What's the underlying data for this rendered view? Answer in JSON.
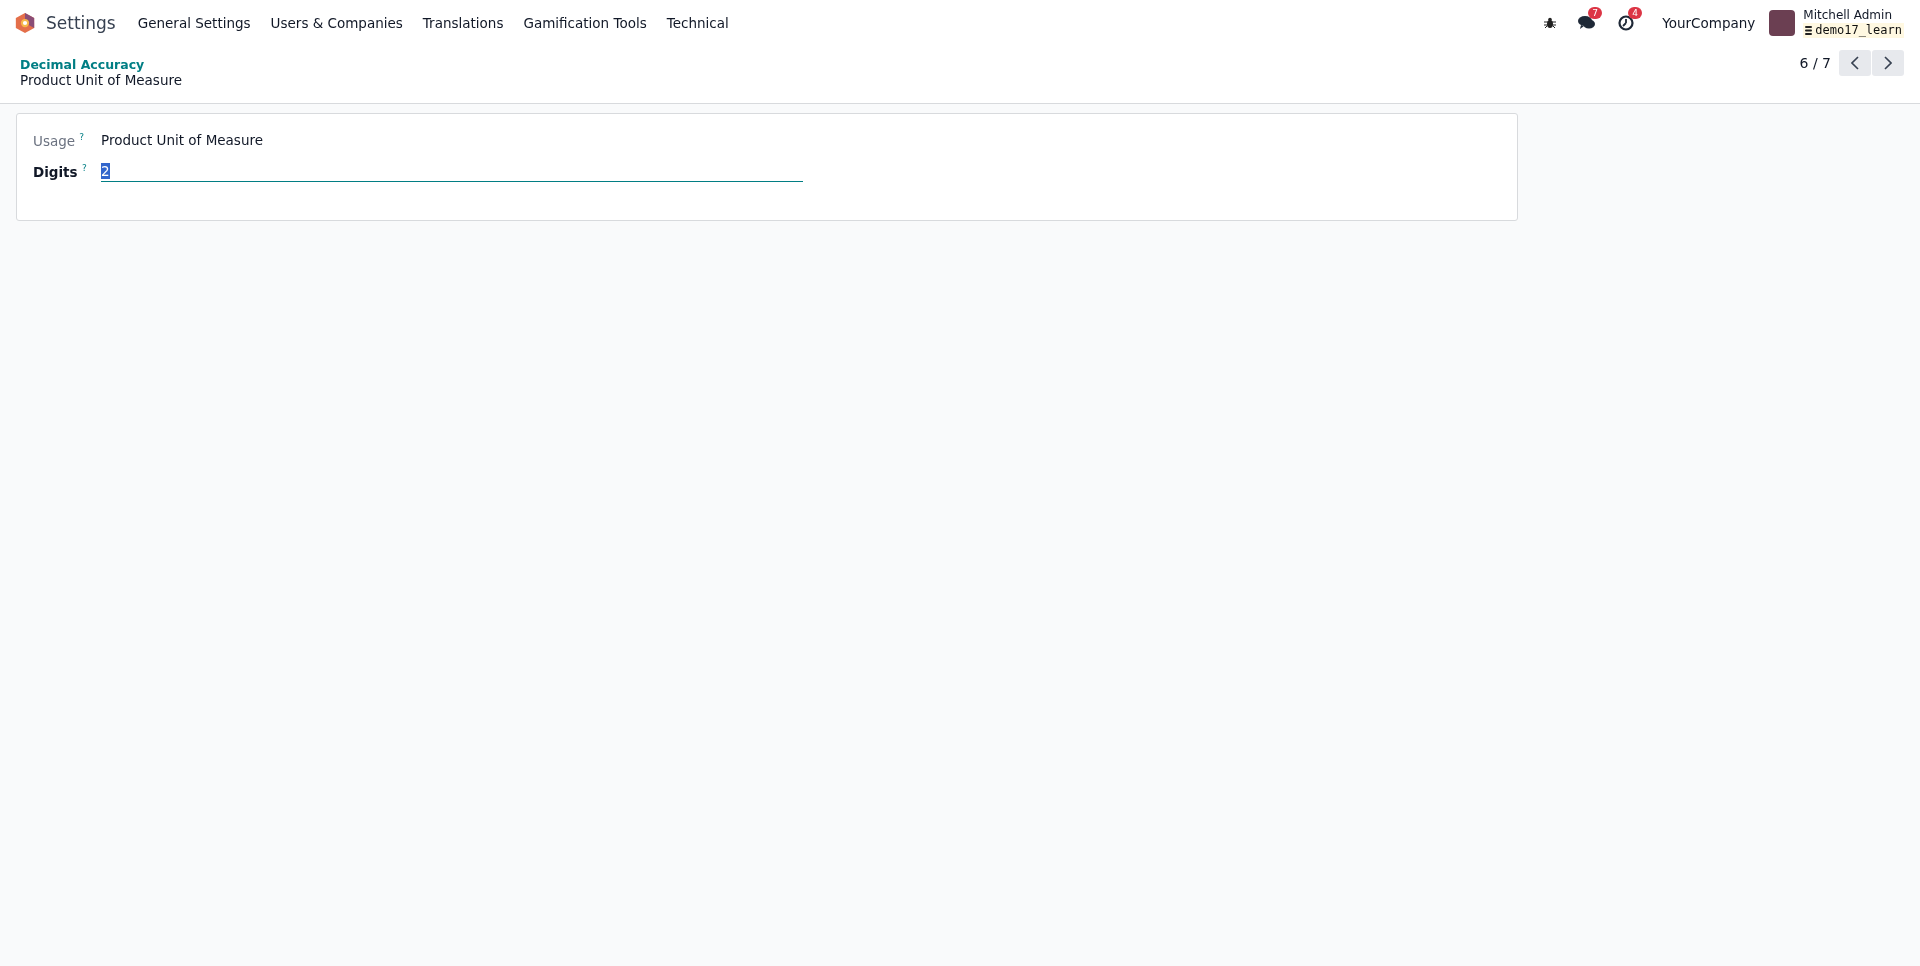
{
  "navbar": {
    "app_name": "Settings",
    "menu": [
      "General Settings",
      "Users & Companies",
      "Translations",
      "Gamification Tools",
      "Technical"
    ],
    "messages_badge": "7",
    "activities_badge": "4",
    "company": "YourCompany",
    "user": "Mitchell Admin",
    "database": "demo17_learn"
  },
  "breadcrumb": {
    "parent": "Decimal Accuracy",
    "current": "Product Unit of Measure"
  },
  "pager": {
    "value": "6 / 7"
  },
  "form": {
    "fields": [
      {
        "kind": "readonly",
        "label": "Usage",
        "help": "?",
        "value": "Product Unit of Measure",
        "required": false
      },
      {
        "kind": "input",
        "label": "Digits",
        "help": "?",
        "value": "2",
        "required": true,
        "text_selected": true
      }
    ]
  }
}
